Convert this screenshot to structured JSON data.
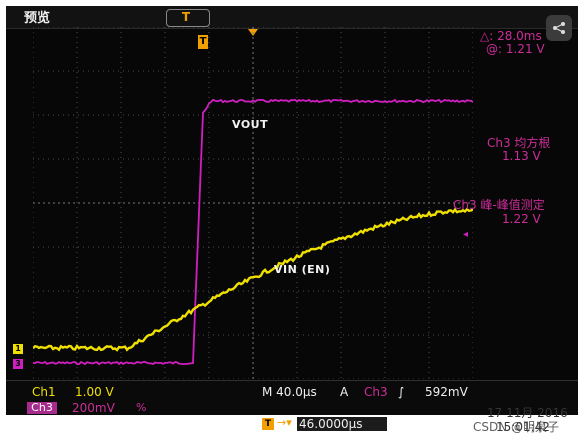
{
  "header": {
    "mode": "预览",
    "trigger_marker": "T",
    "channel_indicator_1": "1",
    "channel_indicator_3": "3"
  },
  "measurements": {
    "delta_time": "△: 28.0ms",
    "cursor_at": "@: 1.21 V",
    "rms_label": "Ch3 均方根",
    "rms_value": "1.13 V",
    "pk2pk_label": "Ch3 峰-峰值测定",
    "pk2pk_value": "1.22 V"
  },
  "signals": {
    "vout": "VOUT",
    "vin": "VIN (EN)"
  },
  "status": {
    "ch1_label": "Ch1",
    "ch1_scale": "1.00 V",
    "ch3_label": "Ch3",
    "ch3_scale": "200mV",
    "ch3_bw": "%",
    "timebase": "M 40.0µs",
    "trigger_mode": "A",
    "trigger_source": "Ch3",
    "trigger_slope": "∫",
    "trigger_level": "592mV",
    "horizontal_position": "46.0000µs",
    "date": "17 11月 2016",
    "time": "15:01:42"
  },
  "watermark": "CSDN @明泉子",
  "colors": {
    "ch1": "#f0e000",
    "ch3": "#d01fc0",
    "trigger": "#f2a000",
    "grid": "#555555"
  },
  "waveforms": {
    "ch1_yellow": {
      "pre_level": 0.9,
      "final_level": 3.05,
      "edge_start_us": 80,
      "edge_end_us": 380
    },
    "ch3_magenta": {
      "pre_level": 0.5,
      "final_level": 1.62,
      "edge_us": 145
    }
  }
}
